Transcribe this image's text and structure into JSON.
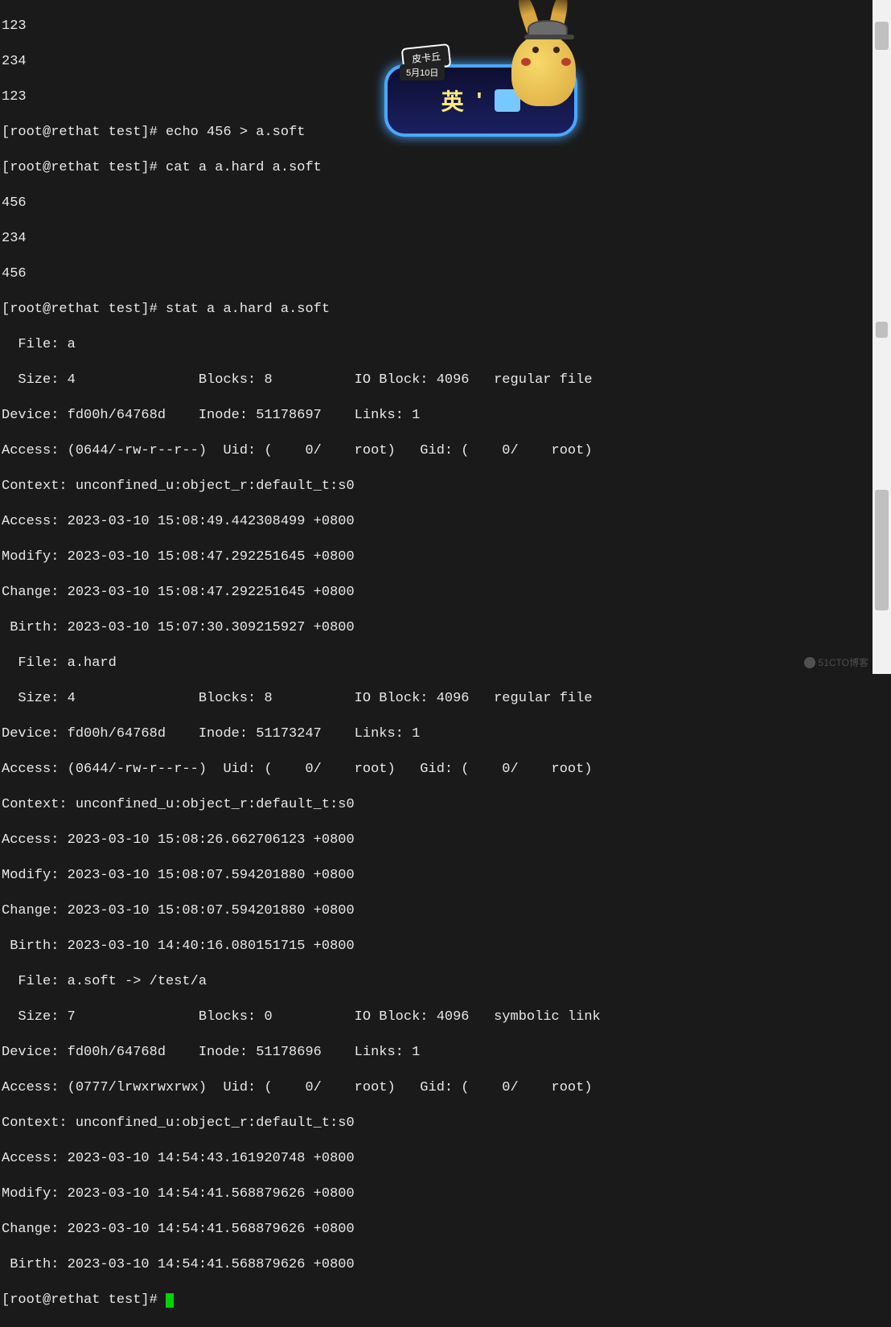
{
  "prompt_prefix": "[root@rethat test]# ",
  "commands": {
    "echo_456": "echo 456 > a.soft",
    "cat_all": "cat a a.hard a.soft",
    "stat_all": "stat a a.hard a.soft"
  },
  "prev_output": [
    "123",
    "234",
    "123"
  ],
  "cat_output": [
    "456",
    "234",
    "456"
  ],
  "stat": [
    {
      "file": "  File: a",
      "size_line": "  Size: 4               Blocks: 8          IO Block: 4096   regular file",
      "device_line": "Device: fd00h/64768d    Inode: 51178697    Links: 1",
      "access_perms": "Access: (0644/-rw-r--r--)  Uid: (    0/    root)   Gid: (    0/    root)",
      "context": "Context: unconfined_u:object_r:default_t:s0",
      "access": "Access: 2023-03-10 15:08:49.442308499 +0800",
      "modify": "Modify: 2023-03-10 15:08:47.292251645 +0800",
      "change": "Change: 2023-03-10 15:08:47.292251645 +0800",
      "birth": " Birth: 2023-03-10 15:07:30.309215927 +0800"
    },
    {
      "file": "  File: a.hard",
      "size_line": "  Size: 4               Blocks: 8          IO Block: 4096   regular file",
      "device_line": "Device: fd00h/64768d    Inode: 51173247    Links: 1",
      "access_perms": "Access: (0644/-rw-r--r--)  Uid: (    0/    root)   Gid: (    0/    root)",
      "context": "Context: unconfined_u:object_r:default_t:s0",
      "access": "Access: 2023-03-10 15:08:26.662706123 +0800",
      "modify": "Modify: 2023-03-10 15:08:07.594201880 +0800",
      "change": "Change: 2023-03-10 15:08:07.594201880 +0800",
      "birth": " Birth: 2023-03-10 14:40:16.080151715 +0800"
    },
    {
      "file": "  File: a.soft -> /test/a",
      "size_line": "  Size: 7               Blocks: 0          IO Block: 4096   symbolic link",
      "device_line": "Device: fd00h/64768d    Inode: 51178696    Links: 1",
      "access_perms": "Access: (0777/lrwxrwxrwx)  Uid: (    0/    root)   Gid: (    0/    root)",
      "context": "Context: unconfined_u:object_r:default_t:s0",
      "access": "Access: 2023-03-10 14:54:43.161920748 +0800",
      "modify": "Modify: 2023-03-10 14:54:41.568879626 +0800",
      "change": "Change: 2023-03-10 14:54:41.568879626 +0800",
      "birth": " Birth: 2023-03-10 14:54:41.568879626 +0800"
    }
  ],
  "overlay": {
    "tag1": "皮卡丘",
    "tag2": "5月10日",
    "glyph1": "英",
    "glyph2": "'",
    "shirt": "👕"
  },
  "watermark": "51CTO博客"
}
